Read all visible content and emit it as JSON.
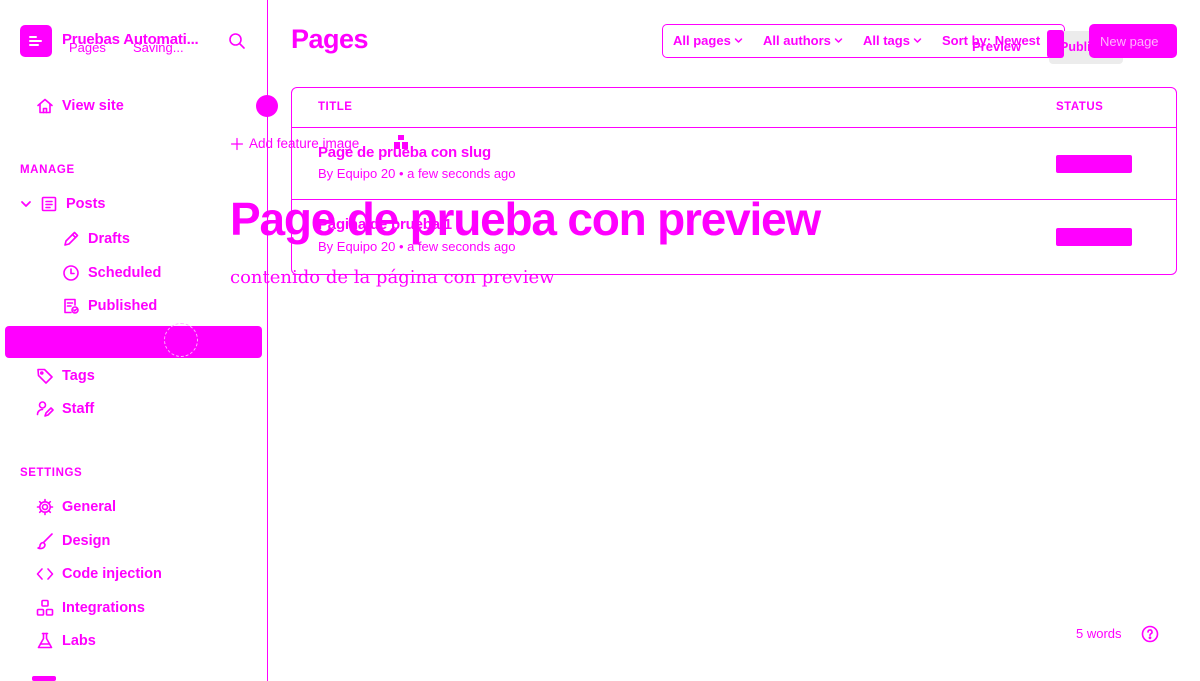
{
  "sidebar": {
    "brand_name": "Pruebas Automati...",
    "breadcrumb_pages": "Pages",
    "breadcrumb_saving": "Saving...",
    "view_site": "View site",
    "manage_title": "MANAGE",
    "posts": "Posts",
    "drafts": "Drafts",
    "scheduled": "Scheduled",
    "published": "Published",
    "tags": "Tags",
    "staff": "Staff",
    "settings_title": "SETTINGS",
    "general": "General",
    "design": "Design",
    "code_injection": "Code injection",
    "integrations": "Integrations",
    "labs": "Labs"
  },
  "main": {
    "title": "Pages",
    "filters": [
      "All pages",
      "All authors",
      "All tags",
      "Sort by: Newest"
    ],
    "preview_label": "Preview",
    "publish_label": "Publi",
    "new_page_label": "New page",
    "table": {
      "col_title": "TITLE",
      "col_status": "STATUS",
      "rows": [
        {
          "title": "Page de prueba con slug",
          "meta": "By Equipo 20 • a few seconds ago"
        },
        {
          "title": "Página de prueba 1",
          "meta": "By Equipo 20 • a few seconds ago"
        }
      ]
    }
  },
  "editor": {
    "add_feature_image": "Add feature image",
    "title": "Page de prueba con preview",
    "body": "contenido de la página con preview",
    "word_count": "5 words"
  },
  "colors": {
    "accent": "#ff00ff",
    "background": "#ffffff",
    "ghost": "#ffb3ff"
  },
  "icons": [
    "menu-icon",
    "search-icon",
    "home-icon",
    "posts-icon",
    "pencil-icon",
    "clock-icon",
    "published-icon",
    "tag-icon",
    "staff-icon",
    "gear-icon",
    "brush-icon",
    "code-icon",
    "integrations-icon",
    "flask-icon",
    "plus-icon",
    "help-icon",
    "chevron-down-icon"
  ]
}
